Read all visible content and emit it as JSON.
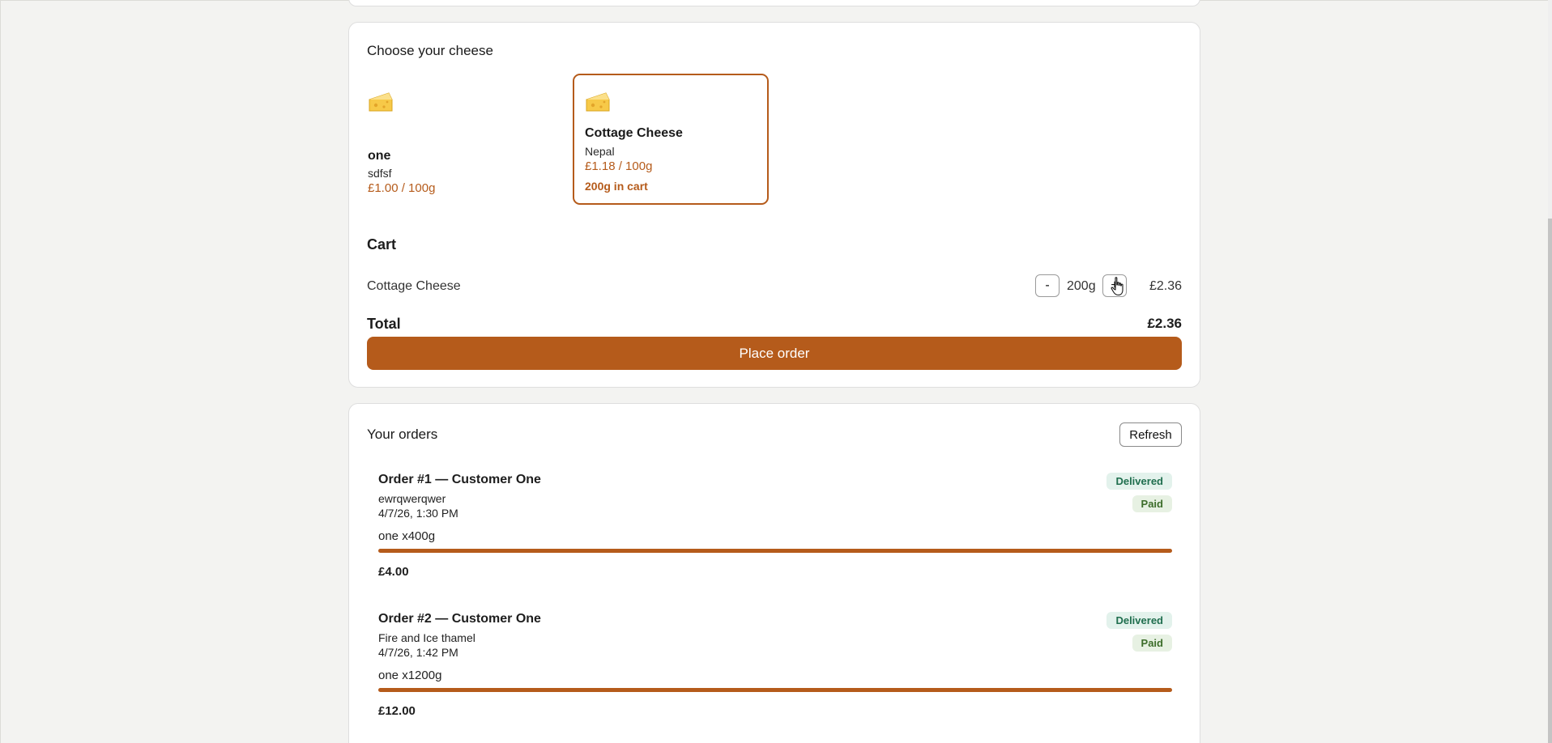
{
  "cheese_section": {
    "title": "Choose your cheese",
    "options": [
      {
        "name": "one",
        "origin": "sdfsf",
        "price": "£1.00 / 100g",
        "in_cart": "",
        "icon": "cheese-icon",
        "selected": false
      },
      {
        "name": "Cottage Cheese",
        "origin": "Nepal",
        "price": "£1.18 / 100g",
        "in_cart": "200g in cart",
        "icon": "cheese-icon",
        "selected": true
      }
    ]
  },
  "cart": {
    "title": "Cart",
    "items": [
      {
        "name": "Cottage Cheese",
        "decrement_label": "-",
        "quantity": "200g",
        "increment_label": "+",
        "line_price": "£2.36"
      }
    ],
    "total_label": "Total",
    "total_value": "£2.36",
    "place_order_label": "Place order"
  },
  "orders": {
    "title": "Your orders",
    "refresh_label": "Refresh",
    "list": [
      {
        "title": "Order #1 — Customer One",
        "address": "ewrqwerqwer",
        "date": "4/7/26, 1:30 PM",
        "items": "one x400g",
        "total": "£4.00",
        "status": "Delivered",
        "payment": "Paid"
      },
      {
        "title": "Order #2 — Customer One",
        "address": "Fire and Ice thamel",
        "date": "4/7/26, 1:42 PM",
        "items": "one x1200g",
        "total": "£12.00",
        "status": "Delivered",
        "payment": "Paid"
      }
    ]
  },
  "colors": {
    "accent": "#b55b1b",
    "background": "#f3f3f1",
    "card": "#ffffff",
    "badge_delivered_bg": "#e3f2ec",
    "badge_paid_bg": "#e7f1e3"
  }
}
